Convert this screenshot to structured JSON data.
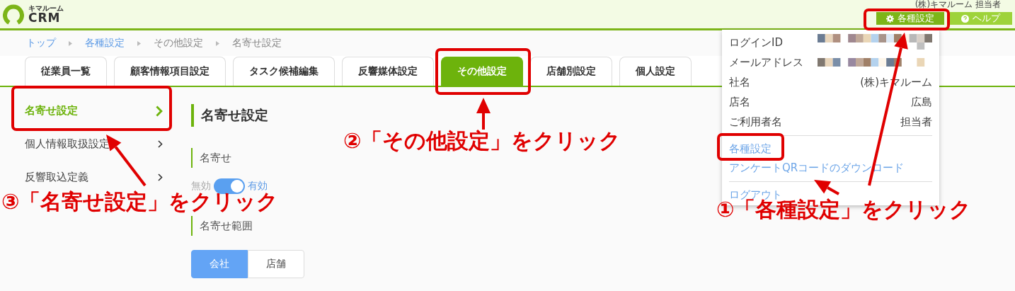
{
  "header": {
    "logo_small": "キマルーム",
    "logo": "CRM",
    "user": "(株)キマルーム 担当者",
    "buttons": [
      {
        "label": "各種設定",
        "kind": "settings"
      },
      {
        "label": "ヘルプ",
        "kind": "help"
      }
    ]
  },
  "breadcrumb": [
    {
      "label": "トップ",
      "link": true
    },
    {
      "label": "各種設定",
      "link": true
    },
    {
      "label": "その他設定",
      "link": false
    },
    {
      "label": "名寄せ設定",
      "link": false
    }
  ],
  "tabs": [
    {
      "label": "従業員一覧",
      "selected": false
    },
    {
      "label": "顧客情報項目設定",
      "selected": false
    },
    {
      "label": "タスク候補編集",
      "selected": false
    },
    {
      "label": "反響媒体設定",
      "selected": false
    },
    {
      "label": "その他設定",
      "selected": true
    },
    {
      "label": "店舗別設定",
      "selected": false
    },
    {
      "label": "個人設定",
      "selected": false
    }
  ],
  "sidebar": {
    "items": [
      {
        "label": "名寄せ設定",
        "selected": true
      },
      {
        "label": "個人情報取扱設定",
        "selected": false
      },
      {
        "label": "反響取込定義",
        "selected": false
      }
    ]
  },
  "main": {
    "title": "名寄せ設定",
    "sections": [
      {
        "kind": "toggle",
        "label": "名寄せ",
        "off_label": "無効",
        "on_label": "有効",
        "on": true
      },
      {
        "kind": "segmented",
        "label": "名寄せ範囲",
        "options": [
          {
            "label": "会社",
            "selected": true
          },
          {
            "label": "店舗",
            "selected": false
          }
        ]
      }
    ]
  },
  "user_menu": {
    "info": [
      {
        "kind": "masked",
        "label": "ログインID"
      },
      {
        "kind": "masked",
        "label": "メールアドレス"
      },
      {
        "kind": "text",
        "label": "社名",
        "value": "(株)キマルーム"
      },
      {
        "kind": "text",
        "label": "店名",
        "value": "広島"
      },
      {
        "kind": "text",
        "label": "ご利用者名",
        "value": "担当者"
      }
    ],
    "link_groups": [
      [
        {
          "label": "各種設定"
        },
        {
          "label": "アンケートQRコードのダウンロード"
        }
      ],
      [
        {
          "label": "ログアウト"
        }
      ]
    ]
  },
  "annotations": {
    "callouts": [
      {
        "text": "②「その他設定」をクリック"
      },
      {
        "text": "③「名寄せ設定」をクリック"
      },
      {
        "text": "①「各種設定」をクリック"
      }
    ]
  }
}
